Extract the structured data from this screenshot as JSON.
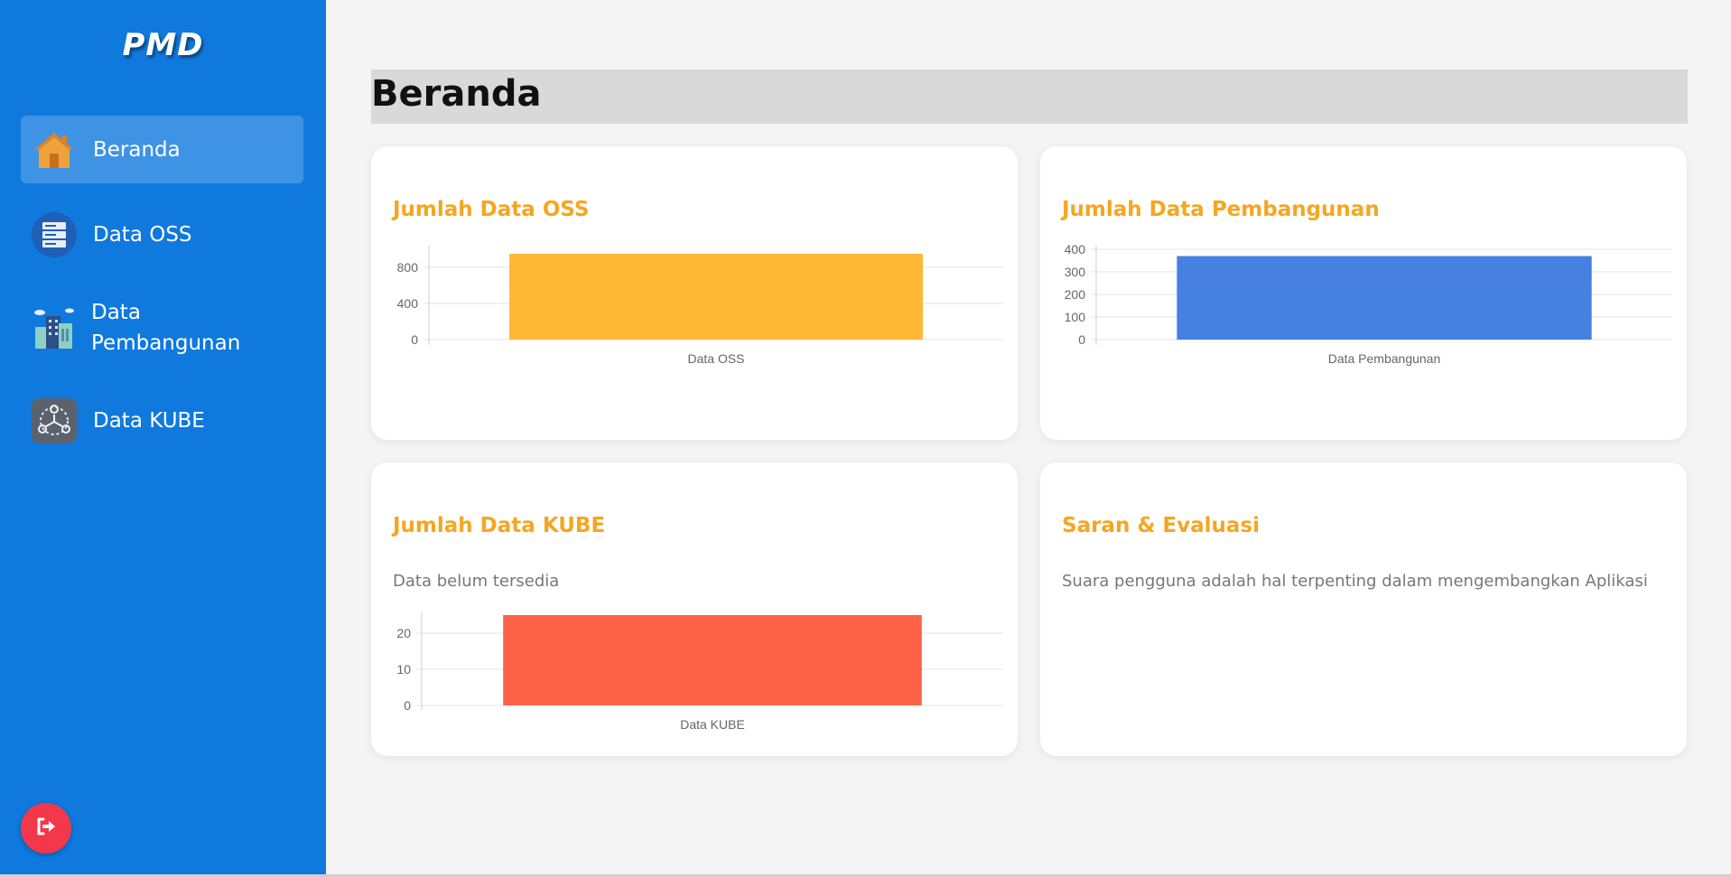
{
  "sidebar": {
    "brand": "PMD",
    "items": [
      {
        "label": "Beranda",
        "icon": "home-icon",
        "active": true
      },
      {
        "label": "Data OSS",
        "icon": "server-icon",
        "active": false
      },
      {
        "label": "Data Pembangunan",
        "icon": "building-icon",
        "active": false
      },
      {
        "label": "Data KUBE",
        "icon": "group-network-icon",
        "active": false
      }
    ],
    "logout_icon": "logout-icon"
  },
  "main": {
    "title": "Beranda",
    "cards": {
      "oss": {
        "title": "Jumlah Data OSS"
      },
      "pembangunan": {
        "title": "Jumlah Data Pembangunan"
      },
      "kube": {
        "title": "Jumlah Data KUBE",
        "note": "Data belum tersedia"
      },
      "saran": {
        "title": "Saran & Evaluasi",
        "text": "Suara pengguna adalah hal terpenting dalam mengembangkan Aplikasi"
      }
    }
  },
  "colors": {
    "sidebar": "#0f79de",
    "accent": "#f5a621",
    "oss_bar": "#ffb833",
    "pembangunan_bar": "#4680e0",
    "kube_bar": "#ff6347",
    "logout": "#f2384a"
  },
  "chart_data": [
    {
      "type": "bar",
      "categories": [
        "Data OSS"
      ],
      "values": [
        950
      ],
      "ylim": [
        0,
        1000
      ],
      "yticks": [
        0,
        400,
        800
      ],
      "color": "#ffb833",
      "grid": true
    },
    {
      "type": "bar",
      "categories": [
        "Data Pembangunan"
      ],
      "values": [
        370
      ],
      "ylim": [
        0,
        400
      ],
      "yticks": [
        0,
        100,
        200,
        300,
        400
      ],
      "color": "#4680e0",
      "grid": true
    },
    {
      "type": "bar",
      "categories": [
        "Data KUBE"
      ],
      "values": [
        25
      ],
      "ylim": [
        0,
        25
      ],
      "yticks": [
        0,
        10,
        20
      ],
      "color": "#ff6347",
      "grid": true
    }
  ]
}
